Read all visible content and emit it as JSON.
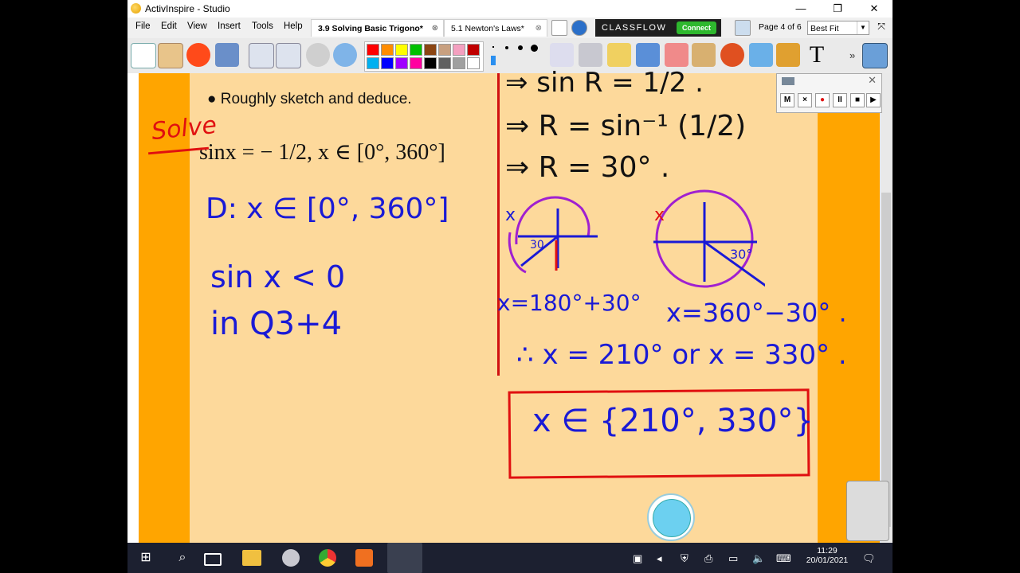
{
  "window": {
    "title": "ActivInspire - Studio"
  },
  "menu": [
    "File",
    "Edit",
    "View",
    "Insert",
    "Tools",
    "Help"
  ],
  "tabs": [
    {
      "label": "3.9 Solving Basic Trigono*",
      "active": true
    },
    {
      "label": "5.1 Newton's Laws*",
      "active": false
    }
  ],
  "classflow": {
    "label": "CLASSFLOW",
    "connect": "Connect"
  },
  "page_info": "Page 4 of 6",
  "zoom": "Best Fit",
  "overflow_chevron": "»",
  "palette": {
    "row1": [
      "#ff0000",
      "#ff8c00",
      "#ffff00",
      "#00c000",
      "#8b4513",
      "#c8a080",
      "#f4a0c0",
      "#c00000"
    ],
    "row2": [
      "#00b0f0",
      "#0000ff",
      "#a000ff",
      "#ff00a0",
      "#000000",
      "#606060",
      "#a0a0a0",
      "#ffffff"
    ]
  },
  "page": {
    "bullet": "Roughly sketch and deduce.",
    "equation": "sinx = − 1/2, x ∈ [0°, 360°]",
    "handwriting": {
      "solve": "Solve",
      "domain": "D: x ∈ [0°, 360°]",
      "sin_neg": "sin x < 0",
      "quadrants": "in Q3+4",
      "step1": "⇒ sin R = 1/2 .",
      "step2": "⇒   R = sin⁻¹ (1/2)",
      "step3": "⇒   R = 30° .",
      "sketch1_x": "x",
      "sketch1_angle": "30",
      "sketch2_x": "x",
      "sketch2_angle": "30°",
      "sol1": "x=180°+30°",
      "sol2": "x=360°−30° .",
      "therefore": "∴ x = 210° or x = 330° .",
      "final": "x ∈ {210°, 330°}"
    }
  },
  "recorder": {
    "buttons": [
      "M",
      "×",
      "●",
      "II",
      "■",
      "▶"
    ]
  },
  "clock": {
    "time": "11:29",
    "date": "20/01/2021"
  }
}
